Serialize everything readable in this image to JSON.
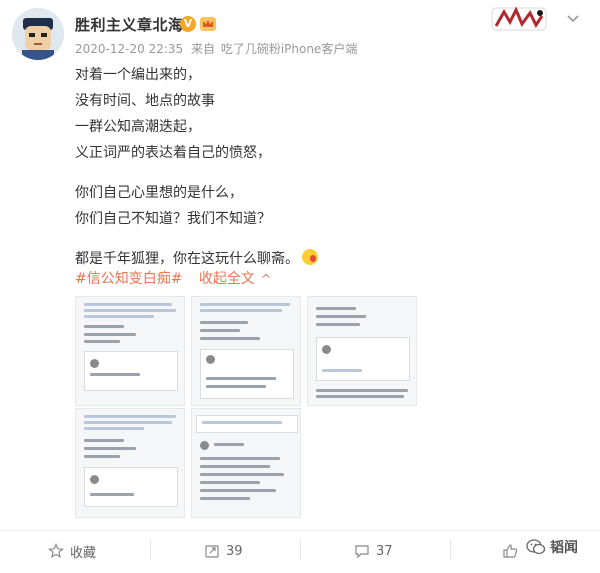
{
  "post": {
    "username": "胜利主义章北海",
    "verified_badge": "V",
    "timestamp": "2020-12-20 22:35",
    "source_prefix": "来自",
    "source": "吃了几碗粉iPhone客户端",
    "lines": [
      "对着一个编出来的，",
      "没有时间、地点的故事",
      "一群公知高潮迭起，",
      "义正词严的表达着自己的愤怒，",
      "你们自己心里想的是什么，",
      "你们自己不知道？我们不知道？",
      "都是千年狐狸，你在这玩什么聊斋。"
    ],
    "hashtag": "#信公知变白痴#",
    "collapse_label": "收起全文",
    "collapse_caret": "^"
  },
  "actions": {
    "favorite_label": "收藏",
    "repost_count": "39",
    "comment_count": "37"
  },
  "watermark": {
    "text": "韬闻"
  },
  "icons": {
    "avatar": "cartoon-avatar-icon",
    "verified": "verified-v-icon",
    "crown": "member-crown-icon",
    "corner": "brand-sticker-icon",
    "menu": "chevron-down-icon",
    "favorite": "star-icon",
    "repost": "repost-icon",
    "comment": "comment-icon",
    "like": "thumbs-up-icon",
    "wechat": "wechat-icon"
  },
  "colors": {
    "accent": "#eb7350",
    "verified": "#f5a623",
    "meta": "#999999",
    "text": "#333333"
  }
}
